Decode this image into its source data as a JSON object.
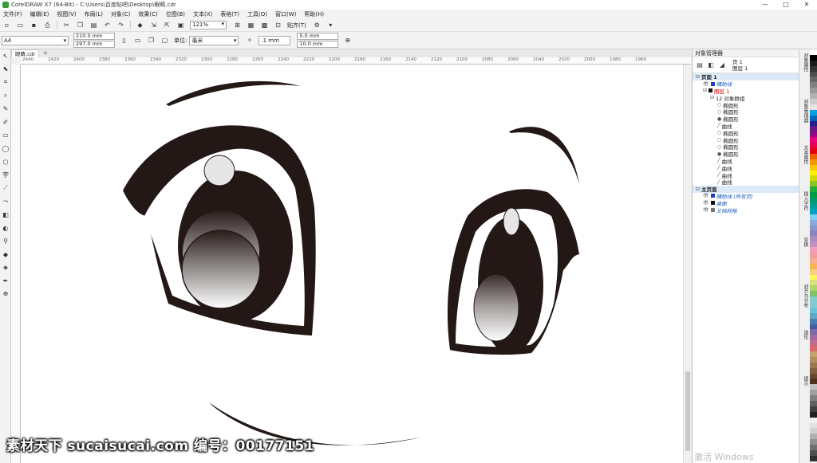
{
  "window": {
    "title": "CorelDRAW X7 (64-Bit) - C:\\Users\\百度贴吧\\Desktop\\眼睛.cdr",
    "minimize": "—",
    "maximize": "□",
    "close": "✕"
  },
  "menu": [
    "文件(F)",
    "编辑(E)",
    "视图(V)",
    "布局(L)",
    "对象(C)",
    "效果(C)",
    "位图(B)",
    "文本(X)",
    "表格(T)",
    "工具(O)",
    "窗口(W)",
    "帮助(H)"
  ],
  "toolbar": {
    "zoom": "121%",
    "snap": "贴齐(T)"
  },
  "propbar": {
    "page_size": "A4",
    "width": "210.0 mm",
    "height": "297.0 mm",
    "unit_label": "单位:",
    "unit": "毫米",
    "nudge": ".1 mm",
    "dup_x": "5.0 mm",
    "dup_y": "10.0 mm"
  },
  "doc_tab": {
    "name": "眼睛.cdr",
    "plus": "+"
  },
  "ruler_labels": [
    "2440",
    "2420",
    "2400",
    "2380",
    "2360",
    "2340",
    "2320",
    "2300",
    "2280",
    "2260",
    "2240",
    "2220",
    "2200",
    "2180",
    "2160",
    "2140",
    "2120",
    "2100",
    "2080",
    "2060",
    "2040",
    "2020",
    "2000",
    "1980",
    "1960"
  ],
  "docker": {
    "title": "对象管理器",
    "page_line1": "页 1",
    "page_line2": "图层 1",
    "tree": [
      {
        "label": "页面 1",
        "indent": 0,
        "style": "bold",
        "prefix": "⊟",
        "sel": true
      },
      {
        "label": "辅助线",
        "indent": 1,
        "style": "blue",
        "prefix": "👁",
        "swatch": "#1f3fb8"
      },
      {
        "label": "图层 1",
        "indent": 1,
        "style": "red",
        "prefix": "⊟",
        "swatch": "#111"
      },
      {
        "label": "12 对象群组",
        "indent": 2,
        "style": "",
        "prefix": "⊟"
      },
      {
        "label": "椭圆形",
        "indent": 3,
        "style": "",
        "prefix": "○"
      },
      {
        "label": "椭圆形",
        "indent": 3,
        "style": "",
        "prefix": "○"
      },
      {
        "label": "椭圆形",
        "indent": 3,
        "style": "",
        "prefix": "●"
      },
      {
        "label": "曲线",
        "indent": 3,
        "style": "",
        "prefix": "╱"
      },
      {
        "label": "椭圆形",
        "indent": 3,
        "style": "",
        "prefix": "○"
      },
      {
        "label": "椭圆形",
        "indent": 3,
        "style": "",
        "prefix": "○"
      },
      {
        "label": "椭圆形",
        "indent": 3,
        "style": "",
        "prefix": "○"
      },
      {
        "label": "椭圆形",
        "indent": 3,
        "style": "",
        "prefix": "●"
      },
      {
        "label": "曲线",
        "indent": 3,
        "style": "",
        "prefix": "╱"
      },
      {
        "label": "曲线",
        "indent": 3,
        "style": "",
        "prefix": "╱"
      },
      {
        "label": "曲线",
        "indent": 3,
        "style": "",
        "prefix": "╱"
      },
      {
        "label": "曲线",
        "indent": 3,
        "style": "",
        "prefix": "╱"
      },
      {
        "label": "主页面",
        "indent": 0,
        "style": "bold",
        "prefix": "⊟",
        "sel": true
      },
      {
        "label": "辅助线 (所有页)",
        "indent": 1,
        "style": "blue",
        "prefix": "👁",
        "swatch": "#1f3fb8"
      },
      {
        "label": "桌面",
        "indent": 1,
        "style": "blue",
        "prefix": "👁",
        "swatch": "#111"
      },
      {
        "label": "文档网格",
        "indent": 1,
        "style": "blue",
        "prefix": "👁",
        "swatch": "#777"
      }
    ]
  },
  "side_tabs": [
    "对象属性",
    "对象管理器",
    "文本属性",
    "插入字符",
    "变换",
    "对齐与分布",
    "造形",
    "提示"
  ],
  "palette_colors": [
    "#ffffff",
    "#000000",
    "#1a1a1a",
    "#333333",
    "#4d4d4d",
    "#666666",
    "#808080",
    "#999999",
    "#b3b3b3",
    "#cccccc",
    "#e6e6e6",
    "#00a0e9",
    "#0068b7",
    "#1d2088",
    "#601986",
    "#920783",
    "#e4007f",
    "#e5004f",
    "#e60012",
    "#eb6100",
    "#f39800",
    "#fcc800",
    "#fff100",
    "#cfdb00",
    "#8fc31f",
    "#22ac38",
    "#009944",
    "#009b6b",
    "#009e96",
    "#00a0c1",
    "#7ecef4",
    "#88abda",
    "#8c97cb",
    "#8f82bc",
    "#aa89bd",
    "#c490bf",
    "#f19ec2",
    "#f29c9f",
    "#f5b090",
    "#f8b551",
    "#facd89",
    "#fff45c",
    "#d7e180",
    "#b3d465",
    "#80c269",
    "#84ccc9",
    "#7fcdd3",
    "#6ac3d8",
    "#5fa8c6",
    "#4b7fb1",
    "#3f5fa0",
    "#7c6aa6",
    "#a06aa5",
    "#c06a8f",
    "#d66a6a",
    "#c8a070",
    "#b09060",
    "#987850",
    "#806040",
    "#684830",
    "#503020",
    "#c0c0c0",
    "#a0a0a0",
    "#808080",
    "#606060",
    "#404040",
    "#202020",
    "#f0f0f0",
    "#e0e0e0",
    "#d0d0d0",
    "#b0b0b0",
    "#909090",
    "#707070",
    "#505050",
    "#303030"
  ],
  "watermark": "素材天下 sucaisucai.com  编号：00177151",
  "activate": "激活 Windows"
}
